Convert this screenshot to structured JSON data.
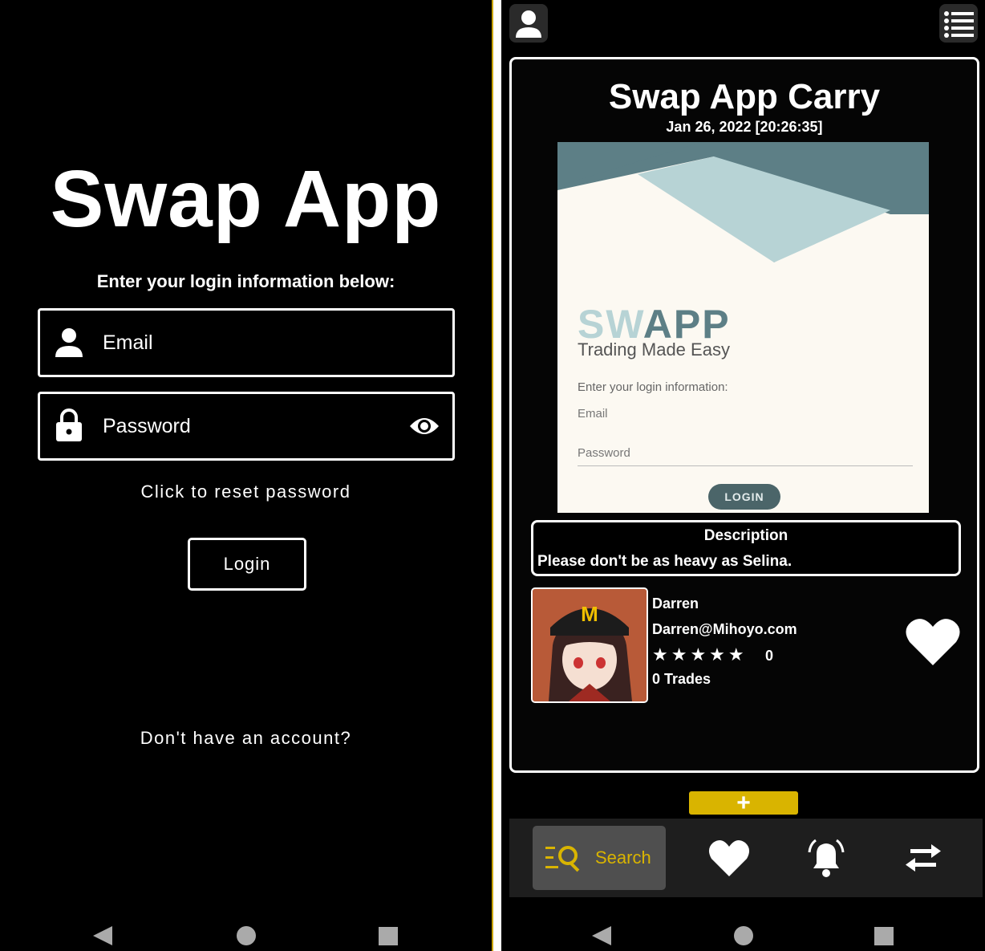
{
  "login": {
    "title": "Swap App",
    "prompt": "Enter your login information below:",
    "email_placeholder": "Email",
    "password_placeholder": "Password",
    "reset_link": "Click to reset password",
    "login_button": "Login",
    "signup_link": "Don't have an account?"
  },
  "post": {
    "title": "Swap App Carry",
    "date": "Jan 26, 2022 [20:26:35]",
    "preview": {
      "logo_part1": "SW",
      "logo_part2": "APP",
      "tagline": "Trading Made Easy",
      "prompt": "Enter your login information:",
      "email": "Email",
      "password": "Password",
      "login_button": "LOGIN",
      "colors": {
        "background": "#fcf9f2",
        "dark_shape": "#5d7f86",
        "light_shape": "#b7d3d5"
      }
    },
    "description_heading": "Description",
    "description_text": "Please don't be as heavy as Selina.",
    "user": {
      "name": "Darren",
      "email": "Darren@Mihoyo.com",
      "stars": "★★★★★",
      "rating": "0",
      "trades": "0 Trades"
    }
  },
  "bottom_nav": {
    "add_label": "+",
    "search_label": "Search",
    "tabs": [
      "search",
      "favorites",
      "notifications",
      "trades"
    ]
  },
  "colors": {
    "accent": "#d9b400",
    "background": "#000000",
    "nav_background": "#1e1e1e"
  },
  "icons": [
    "user-icon",
    "lock-icon",
    "eye-icon",
    "menu-list-icon",
    "heart-icon",
    "bell-icon",
    "swap-arrows-icon",
    "search-filter-icon"
  ]
}
